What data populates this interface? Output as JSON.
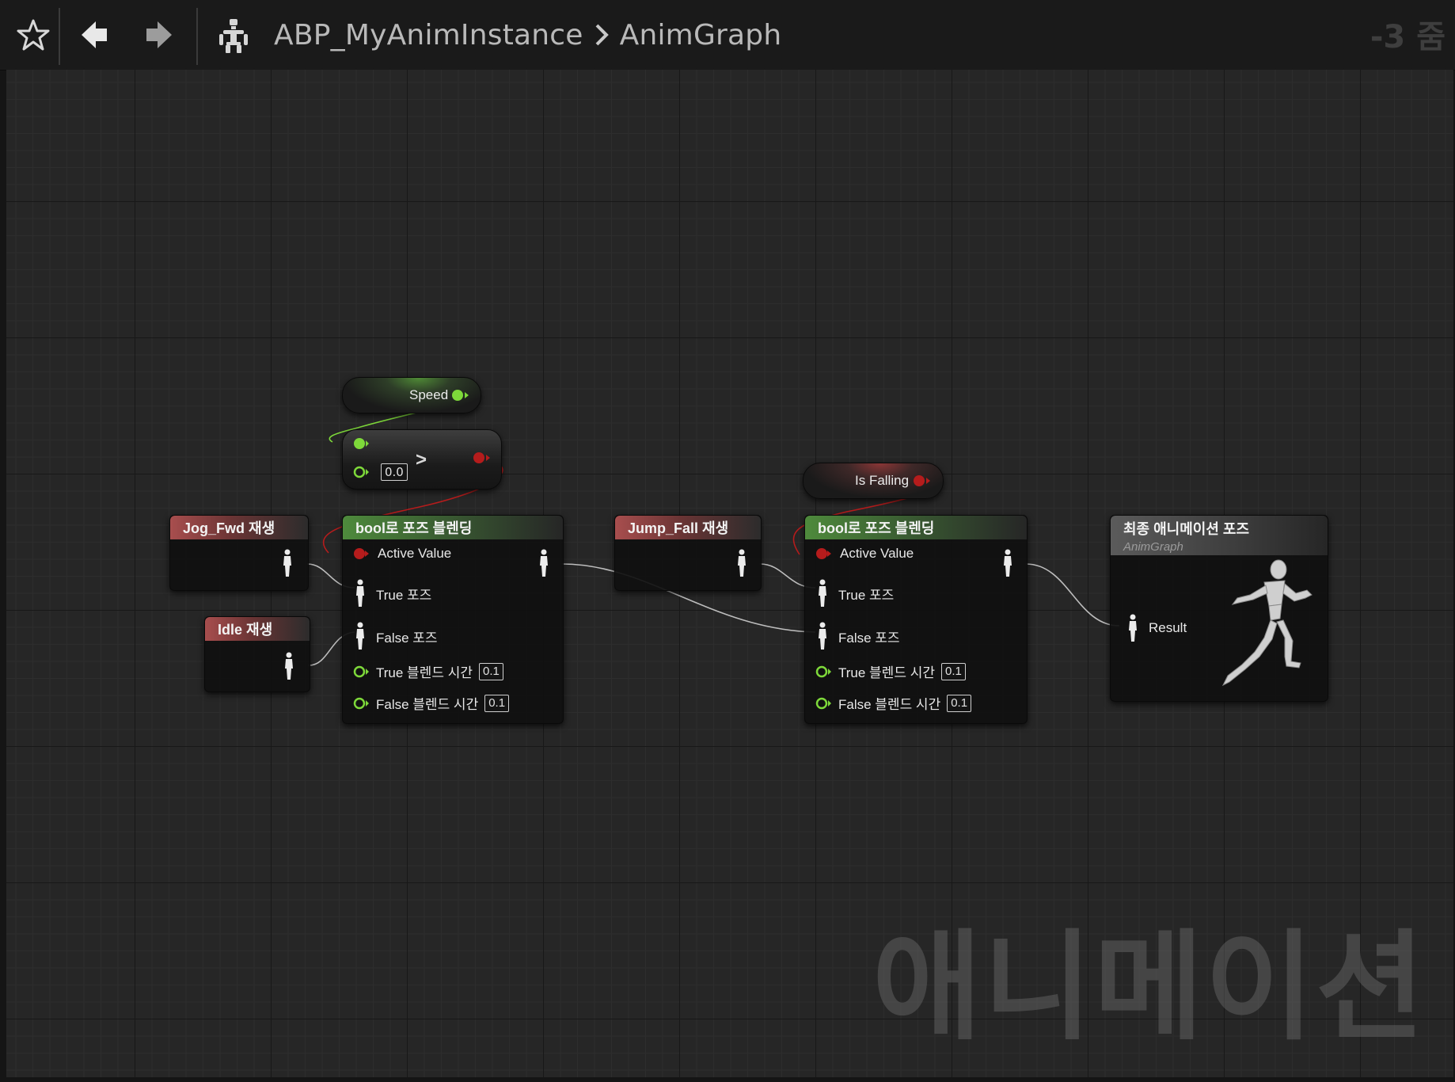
{
  "toolbar": {
    "favorite_icon": "star-icon",
    "back_icon": "arrow-left-icon",
    "forward_icon": "arrow-right-icon",
    "asset_icon": "skeleton-icon"
  },
  "breadcrumb": {
    "asset": "ABP_MyAnimInstance",
    "graph": "AnimGraph"
  },
  "zoom_label": "-3 줌",
  "watermark": "애니메이션",
  "nodes": {
    "speed": {
      "label": "Speed"
    },
    "greater": {
      "op": ">",
      "b_value": "0.0"
    },
    "is_falling": {
      "label": "Is Falling"
    },
    "jog_fwd": {
      "title": "Jog_Fwd 재생"
    },
    "idle": {
      "title": "Idle 재생"
    },
    "jump_fall": {
      "title": "Jump_Fall 재생"
    },
    "blend1": {
      "title": "bool로 포즈 블렌딩",
      "active_value": "Active Value",
      "true_pose": "True 포즈",
      "false_pose": "False 포즈",
      "true_blend_time": "True 블렌드 시간",
      "true_blend_value": "0.1",
      "false_blend_time": "False 블렌드 시간",
      "false_blend_value": "0.1"
    },
    "blend2": {
      "title": "bool로 포즈 블렌딩",
      "active_value": "Active Value",
      "true_pose": "True 포즈",
      "false_pose": "False 포즈",
      "true_blend_time": "True 블렌드 시간",
      "true_blend_value": "0.1",
      "false_blend_time": "False 블렌드 시간",
      "false_blend_value": "0.1"
    },
    "output": {
      "title": "최종 애니메이션 포즈",
      "subtitle": "AnimGraph",
      "result": "Result"
    }
  },
  "colors": {
    "bool_pin": "#b51c1c",
    "float_pin": "#7ed93a",
    "pose_wire": "#bdbdbd",
    "anim_header": "#a84e4e",
    "blend_header": "#4e8a3c"
  }
}
